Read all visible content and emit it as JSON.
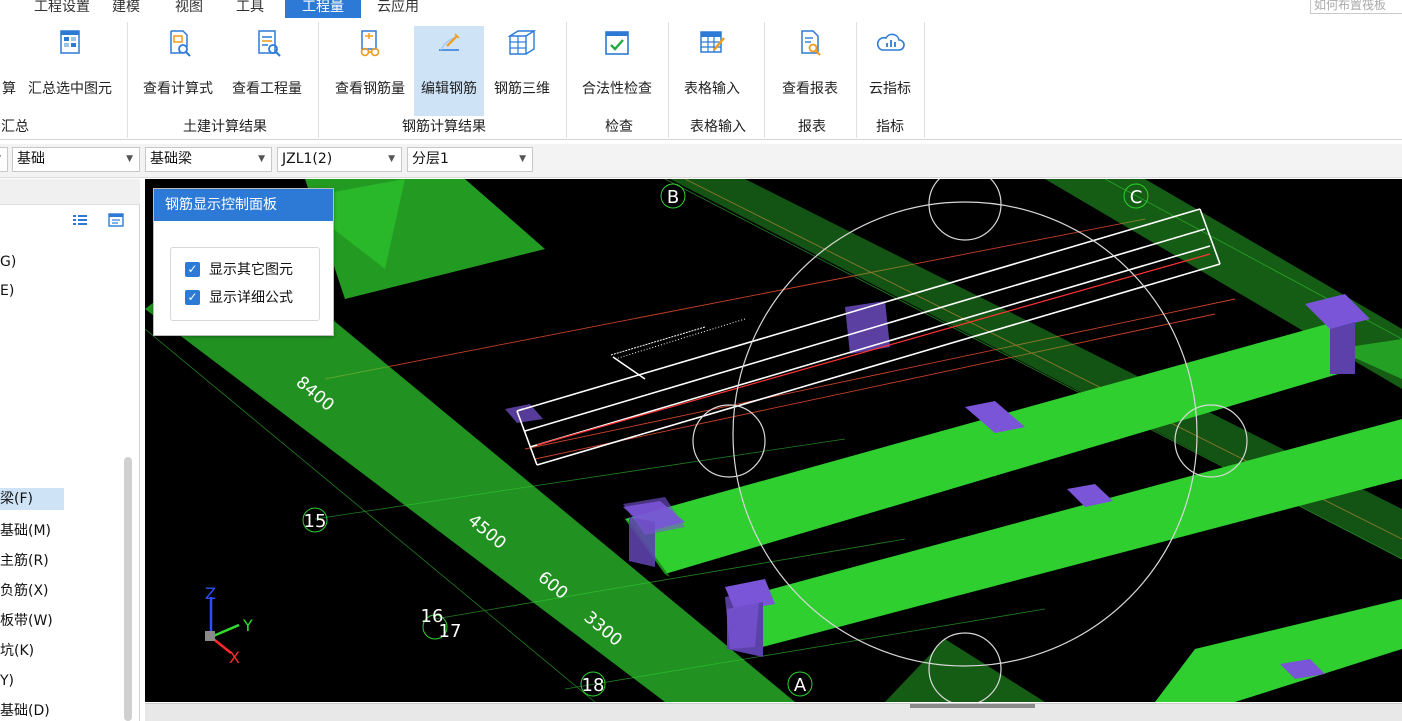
{
  "menu": {
    "tabs": [
      "工程设置",
      "建模",
      "视图",
      "工具",
      "工程量",
      "云应用"
    ],
    "active": "工程量",
    "search_placeholder": "如何布置筏板"
  },
  "ribbon": {
    "buttons": [
      {
        "label": "算",
        "icon": "calc-icon"
      },
      {
        "label": "汇总选中图元",
        "icon": "summary-selected-icon"
      },
      {
        "label": "查看计算式",
        "icon": "view-formula-icon"
      },
      {
        "label": "查看工程量",
        "icon": "view-quantity-icon"
      },
      {
        "label": "查看钢筋量",
        "icon": "view-rebar-quantity-icon"
      },
      {
        "label": "编辑钢筋",
        "icon": "edit-rebar-icon"
      },
      {
        "label": "钢筋三维",
        "icon": "rebar-3d-icon"
      },
      {
        "label": "合法性检查",
        "icon": "validity-check-icon"
      },
      {
        "label": "表格输入",
        "icon": "table-input-icon"
      },
      {
        "label": "查看报表",
        "icon": "view-report-icon"
      },
      {
        "label": "云指标",
        "icon": "cloud-index-icon"
      }
    ],
    "groups": [
      "汇总",
      "土建计算结果",
      "钢筋计算结果",
      "检查",
      "表格输入",
      "报表",
      "指标"
    ]
  },
  "selectors": [
    {
      "value": "基础"
    },
    {
      "value": "基础梁"
    },
    {
      "value": "JZL1(2)"
    },
    {
      "value": "分层1"
    }
  ],
  "left_panel": {
    "items": [
      "G)",
      "E)",
      "梁(F)",
      "基础(M)",
      "主筋(R)",
      "负筋(X)",
      "板带(W)",
      "坑(K)",
      "Y)",
      "基础(D)"
    ],
    "highlighted": "梁(F)"
  },
  "control_panel": {
    "title": "钢筋显示控制面板",
    "options": [
      {
        "label": "显示其它图元",
        "checked": true
      },
      {
        "label": "显示详细公式",
        "checked": true
      }
    ]
  },
  "viewport": {
    "grid_labels": [
      "B",
      "C",
      "A",
      "15",
      "16",
      "17",
      "18"
    ],
    "dimensions": [
      "8400",
      "4500",
      "600",
      "3300"
    ],
    "axis_labels": {
      "x": "X",
      "y": "Y",
      "z": "Z"
    },
    "colors": {
      "beam": "#2fcf2f",
      "column": "#7a55d8",
      "rebar": "#ffffff",
      "grid_line": "#c8402a"
    }
  }
}
